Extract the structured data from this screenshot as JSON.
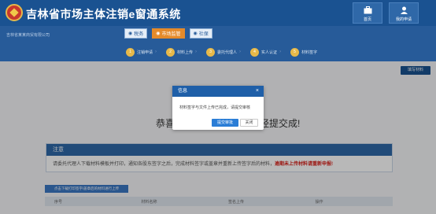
{
  "header": {
    "title": "吉林省市场主体注销e窗通系统",
    "home_label": "首页",
    "my_apply_label": "我的申请",
    "home_icon": "briefcase-icon",
    "user_icon": "user-icon",
    "logo_icon": "national-emblem-icon"
  },
  "banner": {
    "user_info": "吉林省某某商贸有限公司",
    "tabs": [
      {
        "label": "税务",
        "icon": "eye-icon"
      },
      {
        "label": "市场监管",
        "icon": "eye-icon"
      },
      {
        "label": "社保",
        "icon": "eye-icon"
      }
    ],
    "steps": [
      {
        "num": "1",
        "label": "注销申请"
      },
      {
        "num": "2",
        "label": "材料上传"
      },
      {
        "num": "3",
        "label": "委托代理人"
      },
      {
        "num": "4",
        "label": "实人认证"
      },
      {
        "num": "5",
        "label": "材料签字"
      }
    ]
  },
  "fill_button_label": "填写材料",
  "congrats_text": "恭喜您，您的注销材料已经提交成!",
  "notice": {
    "title": "注意",
    "body": "请委托代理人下载材料模板并打印，通知各股东签字之后，完成材料签字或盖章并重新上传签字后的材料，",
    "warning": "逾期未上传材料请重新申报!"
  },
  "download_button_label": "点击下载打印签字/盖章后的材料进行上传",
  "table": {
    "columns": [
      "序号",
      "材料名称",
      "签名上传",
      "操作"
    ]
  },
  "dialog": {
    "title": "信息",
    "message": "材料签字与文件上传已完成，请提交审核",
    "ok_label": "提交审批",
    "cancel_label": "关闭",
    "close_icon": "×"
  },
  "colors": {
    "header": "#1a5291",
    "accent": "#e48a2a",
    "warning": "#d9221b"
  }
}
